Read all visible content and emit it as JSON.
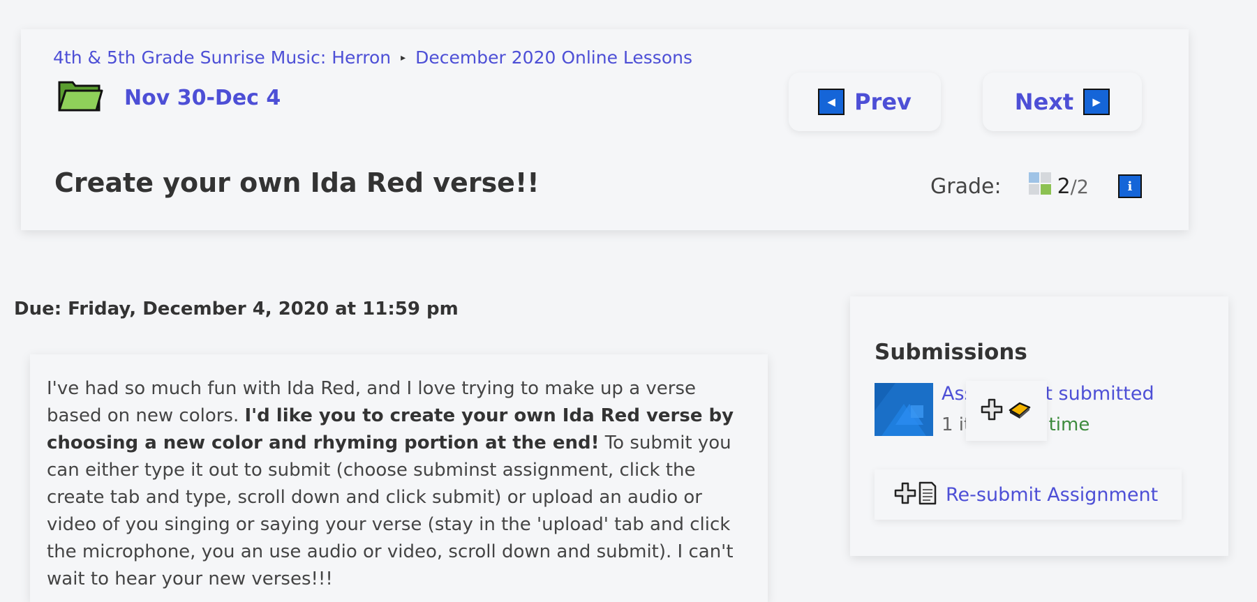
{
  "breadcrumb": {
    "course": "4th & 5th Grade Sunrise Music: Herron",
    "separator": "▸",
    "folder": "December 2020 Online Lessons"
  },
  "folder": {
    "icon": "folder-icon",
    "title": "Nov 30-Dec 4"
  },
  "nav": {
    "prev_label": "Prev",
    "next_label": "Next"
  },
  "assignment": {
    "title": "Create your own Ida Red verse!!",
    "grade_label": "Grade:",
    "grade_score": "2",
    "grade_total": "/2",
    "info_label": "i",
    "due": "Due: Friday, December 4, 2020 at 11:59 pm"
  },
  "instructions": {
    "p1": "I've had so much fun with Ida Red, and I love trying to make up a verse based on new colors.  ",
    "bold": "I'd like you to create your own Ida Red verse by choosing a new color and rhyming portion at the end!",
    "p2": "  To submit you can either type it out to submit (choose subminst assignment, click the create tab and type, scroll down and click submit) or upload an audio or video of you singing or saying your verse (stay in the 'upload' tab and click the microphone, you an use audio or video, scroll down and submit).   I can't wait to hear your new verses!!!"
  },
  "submissions": {
    "heading": "Submissions",
    "item_link": "Assignment submitted",
    "item_count": "1 item",
    "meta_sep": " · ",
    "item_status": "On time",
    "resubmit_label": "Re-submit Assignment"
  },
  "colors": {
    "link": "#4d4fd6",
    "accent_blue": "#1565d8",
    "on_time": "#3d8b3d",
    "folder_green": "#7cc24e"
  }
}
